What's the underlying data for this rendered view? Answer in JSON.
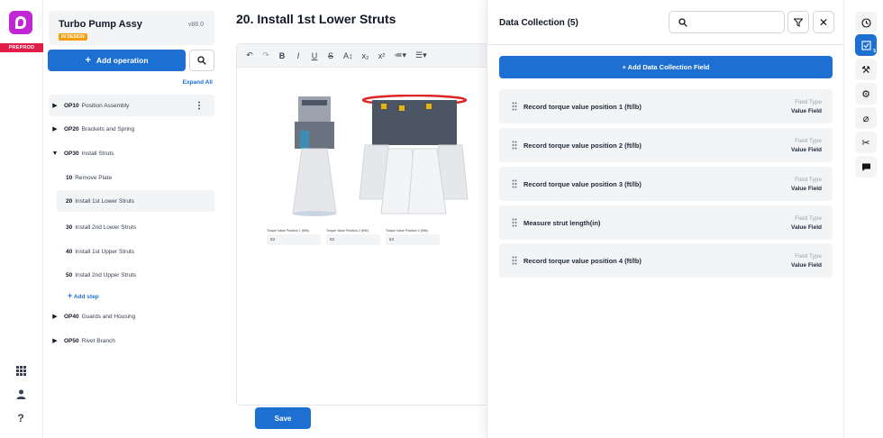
{
  "env": {
    "label": "PREPROD"
  },
  "assembly": {
    "title": "Turbo Pump Assy",
    "version": "v88.0",
    "status": "IN DESIGN"
  },
  "actions": {
    "add_operation": "Add operation",
    "expand_all": "Expand All",
    "add_step": "Add step",
    "save": "Save"
  },
  "operations": [
    {
      "num": "OP10",
      "name": "Position Assembly"
    },
    {
      "num": "OP20",
      "name": "Brackets and Spring"
    },
    {
      "num": "OP30",
      "name": "Install Struts"
    },
    {
      "num": "OP40",
      "name": "Guards and Housing"
    },
    {
      "num": "OP50",
      "name": "Rivet Branch"
    }
  ],
  "steps": [
    {
      "num": "10",
      "name": "Remove Plate"
    },
    {
      "num": "20",
      "name": "Install 1st Lower Struts"
    },
    {
      "num": "30",
      "name": "Install 2nd Lower Struts"
    },
    {
      "num": "40",
      "name": "Install 1st Upper Struts"
    },
    {
      "num": "50",
      "name": "Install 2nd Upper Struts"
    }
  ],
  "editor": {
    "step_title": "20. Install 1st Lower Struts",
    "mini_fields": [
      {
        "label": "Torque Value Position 1 (ft/lb)",
        "value": "63"
      },
      {
        "label": "Torque Value Position 2 (ft/lb)",
        "value": "63"
      },
      {
        "label": "Torque Value Position 3 (ft/lb)",
        "value": "63"
      }
    ]
  },
  "data_collection": {
    "title": "Data Collection (5)",
    "add_label": "+ Add Data Collection Field",
    "field_type_label": "Field Type",
    "items": [
      {
        "name": "Record torque value position 1 (ft/lb)",
        "type": "Value Field"
      },
      {
        "name": "Record torque value position 2 (ft/lb)",
        "type": "Value Field"
      },
      {
        "name": "Record torque value position 3 (ft/lb)",
        "type": "Value Field"
      },
      {
        "name": "Measure strut length(in)",
        "type": "Value Field"
      },
      {
        "name": "Record torque value position 4 (ft/lb)",
        "type": "Value Field"
      }
    ]
  },
  "right_rail": {
    "active_count": "5"
  },
  "colors": {
    "primary": "#1d6fd1",
    "brand": "#c026d3",
    "preprod": "#e11d48",
    "badge": "#f59e0b"
  }
}
